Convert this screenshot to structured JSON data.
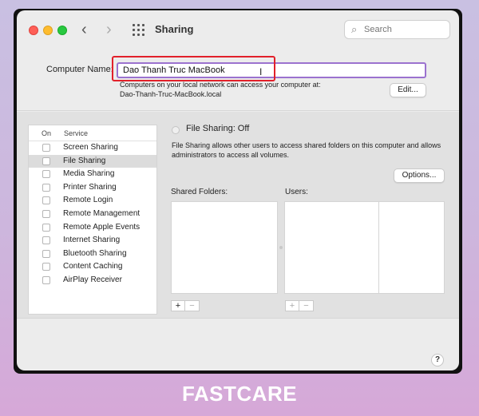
{
  "window": {
    "title": "Sharing"
  },
  "search": {
    "placeholder": "Search"
  },
  "computer_name": {
    "label": "Computer Name:",
    "value": "Dao Thanh Truc MacBook",
    "info_line1": "Computers on your local network can access your computer at:",
    "info_line2": "Dao-Thanh-Truc-MacBook.local",
    "edit_label": "Edit..."
  },
  "services": {
    "col_on": "On",
    "col_service": "Service",
    "selected_index": 1,
    "items": [
      {
        "label": "Screen Sharing",
        "on": false
      },
      {
        "label": "File Sharing",
        "on": false
      },
      {
        "label": "Media Sharing",
        "on": false
      },
      {
        "label": "Printer Sharing",
        "on": false
      },
      {
        "label": "Remote Login",
        "on": false
      },
      {
        "label": "Remote Management",
        "on": false
      },
      {
        "label": "Remote Apple Events",
        "on": false
      },
      {
        "label": "Internet Sharing",
        "on": false
      },
      {
        "label": "Bluetooth Sharing",
        "on": false
      },
      {
        "label": "Content Caching",
        "on": false
      },
      {
        "label": "AirPlay Receiver",
        "on": false
      }
    ]
  },
  "detail": {
    "status": "File Sharing: Off",
    "description": "File Sharing allows other users to access shared folders on this computer and allows administrators to access all volumes.",
    "options_label": "Options...",
    "shared_folders_label": "Shared Folders:",
    "users_label": "Users:",
    "plus": "+",
    "minus": "−"
  },
  "help": {
    "label": "?"
  },
  "watermark": "FASTCARE",
  "colors": {
    "highlight": "#e2202a",
    "focus_ring": "#9b72cf",
    "traffic_red": "#fe5f57",
    "traffic_yellow": "#febc2e",
    "traffic_green": "#28c840"
  }
}
